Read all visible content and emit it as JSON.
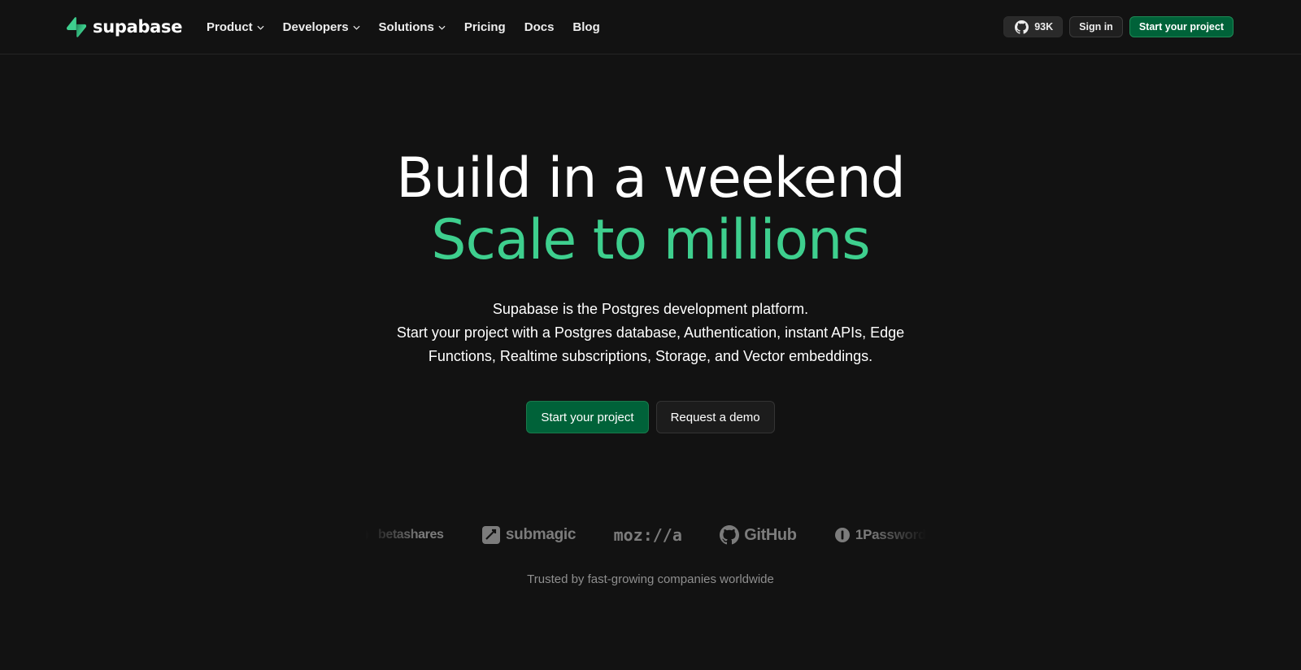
{
  "brand": {
    "name": "supabase",
    "logo_icon": "bolt-icon",
    "accent_color": "#3ecf8e"
  },
  "nav": {
    "items": [
      {
        "label": "Product",
        "has_dropdown": true
      },
      {
        "label": "Developers",
        "has_dropdown": true
      },
      {
        "label": "Solutions",
        "has_dropdown": true
      },
      {
        "label": "Pricing",
        "has_dropdown": false
      },
      {
        "label": "Docs",
        "has_dropdown": false
      },
      {
        "label": "Blog",
        "has_dropdown": false
      }
    ],
    "github_stars": "93K",
    "github_icon": "github-icon",
    "sign_in_label": "Sign in",
    "start_label": "Start your project"
  },
  "hero": {
    "title_line1": "Build in a weekend",
    "title_line2": "Scale to millions",
    "description_lines": [
      "Supabase is the Postgres development platform.",
      "Start your project with a Postgres database, Authentication, instant APIs, Edge",
      "Functions, Realtime subscriptions, Storage, and Vector embeddings."
    ],
    "primary_cta": "Start your project",
    "secondary_cta": "Request a demo"
  },
  "customers": {
    "logos": [
      "betashares",
      "submagic",
      "moz://a",
      "GitHub",
      "1Password"
    ],
    "caption": "Trusted by fast-growing companies worldwide"
  },
  "colors": {
    "background": "#121212",
    "primary_button": "#006239",
    "muted_text": "#8f8f8f"
  }
}
